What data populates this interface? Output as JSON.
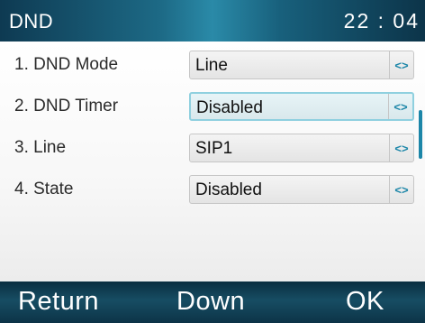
{
  "header": {
    "title": "DND",
    "time": "22 : 04"
  },
  "items": [
    {
      "label": "1. DND Mode",
      "value": "Line"
    },
    {
      "label": "2. DND Timer",
      "value": "Disabled"
    },
    {
      "label": "3. Line",
      "value": "SIP1"
    },
    {
      "label": "4. State",
      "value": "Disabled"
    }
  ],
  "softkeys": {
    "left": "Return",
    "middle": "Down",
    "right": "OK"
  },
  "arrow_glyph": "<>",
  "colors": {
    "accent": "#1c86a8",
    "header": "#1d6a86",
    "selected_border": "#8fd0df"
  },
  "icons": {
    "field_selector": "left-right-arrows-icon"
  }
}
